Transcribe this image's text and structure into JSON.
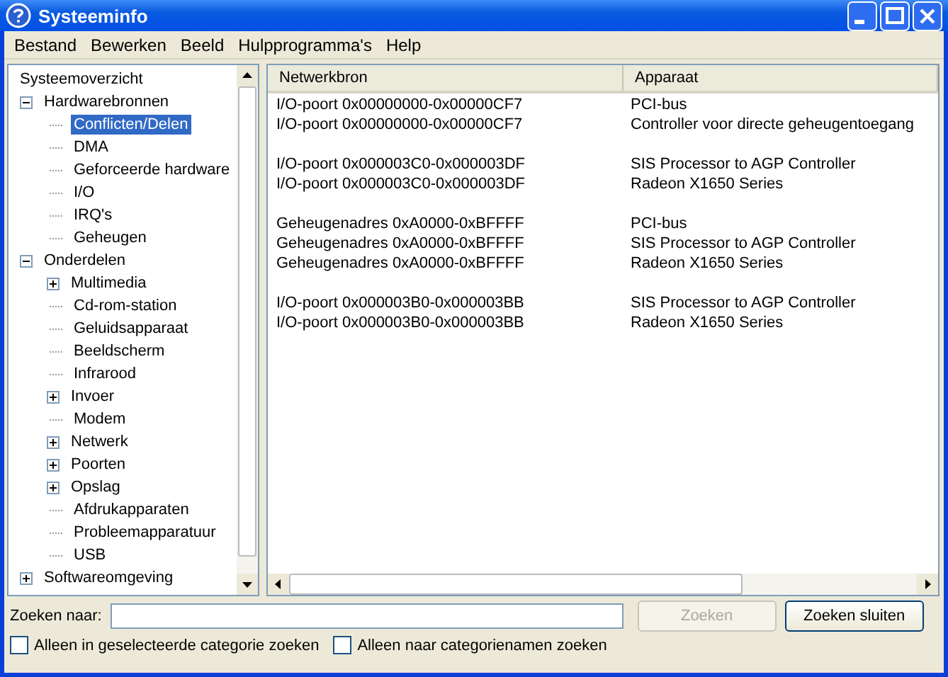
{
  "window": {
    "title": "Systeeminfo"
  },
  "menu": [
    "Bestand",
    "Bewerken",
    "Beeld",
    "Hulpprogramma's",
    "Help"
  ],
  "tree": [
    {
      "label": "Systeemoverzicht",
      "selected": false,
      "children": [
        {
          "label": "Hardwarebronnen",
          "selected": false,
          "expanded": true,
          "children": [
            {
              "label": "Conflicten/Delen",
              "selected": true
            },
            {
              "label": "DMA",
              "selected": false
            },
            {
              "label": "Geforceerde hardware",
              "selected": false
            },
            {
              "label": "I/O",
              "selected": false
            },
            {
              "label": "IRQ's",
              "selected": false
            },
            {
              "label": "Geheugen",
              "selected": false
            }
          ]
        },
        {
          "label": "Onderdelen",
          "selected": false,
          "expanded": true,
          "children": [
            {
              "label": "Multimedia",
              "selected": false,
              "expanded": false
            },
            {
              "label": "Cd-rom-station",
              "selected": false
            },
            {
              "label": "Geluidsapparaat",
              "selected": false
            },
            {
              "label": "Beeldscherm",
              "selected": false
            },
            {
              "label": "Infrarood",
              "selected": false
            },
            {
              "label": "Invoer",
              "selected": false,
              "expanded": false
            },
            {
              "label": "Modem",
              "selected": false
            },
            {
              "label": "Netwerk",
              "selected": false,
              "expanded": false
            },
            {
              "label": "Poorten",
              "selected": false,
              "expanded": false
            },
            {
              "label": "Opslag",
              "selected": false,
              "expanded": false
            },
            {
              "label": "Afdrukapparaten",
              "selected": false
            },
            {
              "label": "Probleemapparatuur",
              "selected": false
            },
            {
              "label": "USB",
              "selected": false
            }
          ]
        },
        {
          "label": "Softwareomgeving",
          "selected": false,
          "expanded": false
        }
      ]
    }
  ],
  "table": {
    "columns": [
      "Netwerkbron",
      "Apparaat"
    ],
    "groups": [
      [
        [
          "I/O-poort 0x00000000-0x00000CF7",
          "PCI-bus"
        ],
        [
          "I/O-poort 0x00000000-0x00000CF7",
          "Controller voor directe geheugentoegang"
        ]
      ],
      [
        [
          "I/O-poort 0x000003C0-0x000003DF",
          "SIS Processor to AGP Controller"
        ],
        [
          "I/O-poort 0x000003C0-0x000003DF",
          "Radeon X1650 Series"
        ]
      ],
      [
        [
          "Geheugenadres 0xA0000-0xBFFFF",
          "PCI-bus"
        ],
        [
          "Geheugenadres 0xA0000-0xBFFFF",
          "SIS Processor to AGP Controller"
        ],
        [
          "Geheugenadres 0xA0000-0xBFFFF",
          "Radeon X1650 Series"
        ]
      ],
      [
        [
          "I/O-poort 0x000003B0-0x000003BB",
          "SIS Processor to AGP Controller"
        ],
        [
          "I/O-poort 0x000003B0-0x000003BB",
          "Radeon X1650 Series"
        ]
      ]
    ]
  },
  "search": {
    "label": "Zoeken naar:",
    "button": "Zoeken",
    "button_disabled": true,
    "close_button": "Zoeken sluiten"
  },
  "options": [
    {
      "label": "Alleen in geselecteerde categorie zoeken",
      "checked": false
    },
    {
      "label": "Alleen naar categorienamen zoeken",
      "checked": false
    }
  ]
}
